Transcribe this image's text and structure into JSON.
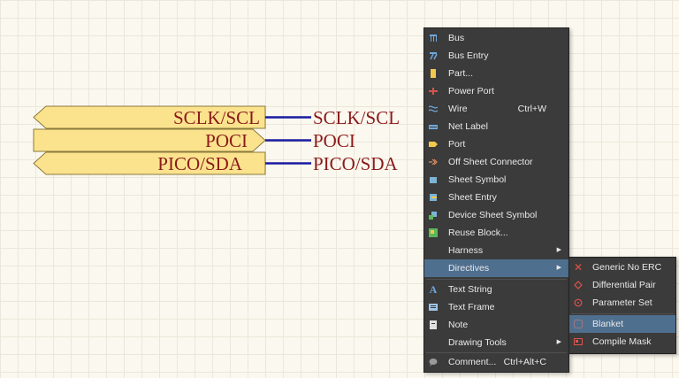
{
  "schematic": {
    "ports": [
      {
        "name": "SCLK/SCL",
        "style": "left-arrow"
      },
      {
        "name": "POCI",
        "style": "right-arrow"
      },
      {
        "name": "PICO/SDA",
        "style": "left-arrow"
      }
    ],
    "net_labels": [
      "SCLK/SCL",
      "POCI",
      "PICO/SDA"
    ],
    "colors": {
      "port_fill": "#fbe38e",
      "port_border": "#8a7a3a",
      "wire": "#1a1aa0",
      "text": "#8b1a1a"
    }
  },
  "context_menu": {
    "items": [
      {
        "label": "Bus",
        "icon": "bus-icon"
      },
      {
        "label": "Bus Entry",
        "icon": "bus-entry-icon"
      },
      {
        "label": "Part...",
        "icon": "part-icon"
      },
      {
        "label": "Power Port",
        "icon": "power-port-icon"
      },
      {
        "label": "Wire",
        "icon": "wire-icon",
        "shortcut": "Ctrl+W"
      },
      {
        "label": "Net Label",
        "icon": "net-label-icon"
      },
      {
        "label": "Port",
        "icon": "port-icon"
      },
      {
        "label": "Off Sheet Connector",
        "icon": "off-sheet-connector-icon"
      },
      {
        "label": "Sheet Symbol",
        "icon": "sheet-symbol-icon"
      },
      {
        "label": "Sheet Entry",
        "icon": "sheet-entry-icon"
      },
      {
        "label": "Device Sheet Symbol",
        "icon": "device-sheet-symbol-icon"
      },
      {
        "label": "Reuse Block...",
        "icon": "reuse-block-icon"
      },
      {
        "label": "Harness",
        "icon": "",
        "submenu": true
      },
      {
        "label": "Directives",
        "icon": "",
        "submenu": true,
        "highlighted": true
      },
      {
        "label": "Text String",
        "icon": "text-string-icon"
      },
      {
        "label": "Text Frame",
        "icon": "text-frame-icon"
      },
      {
        "label": "Note",
        "icon": "note-icon"
      },
      {
        "label": "Drawing Tools",
        "icon": "",
        "submenu": true
      },
      {
        "label": "Comment...",
        "icon": "comment-icon",
        "shortcut": "Ctrl+Alt+C"
      }
    ]
  },
  "directives_submenu": {
    "items": [
      {
        "label": "Generic No ERC",
        "icon": "generic-no-erc-icon"
      },
      {
        "label": "Differential Pair",
        "icon": "differential-pair-icon"
      },
      {
        "label": "Parameter Set",
        "icon": "parameter-set-icon"
      },
      {
        "label": "Blanket",
        "icon": "blanket-icon",
        "highlighted": true
      },
      {
        "label": "Compile Mask",
        "icon": "compile-mask-icon"
      }
    ]
  },
  "accent": {
    "highlight": "#4f6f8f",
    "menu_bg": "#3b3b3b"
  }
}
